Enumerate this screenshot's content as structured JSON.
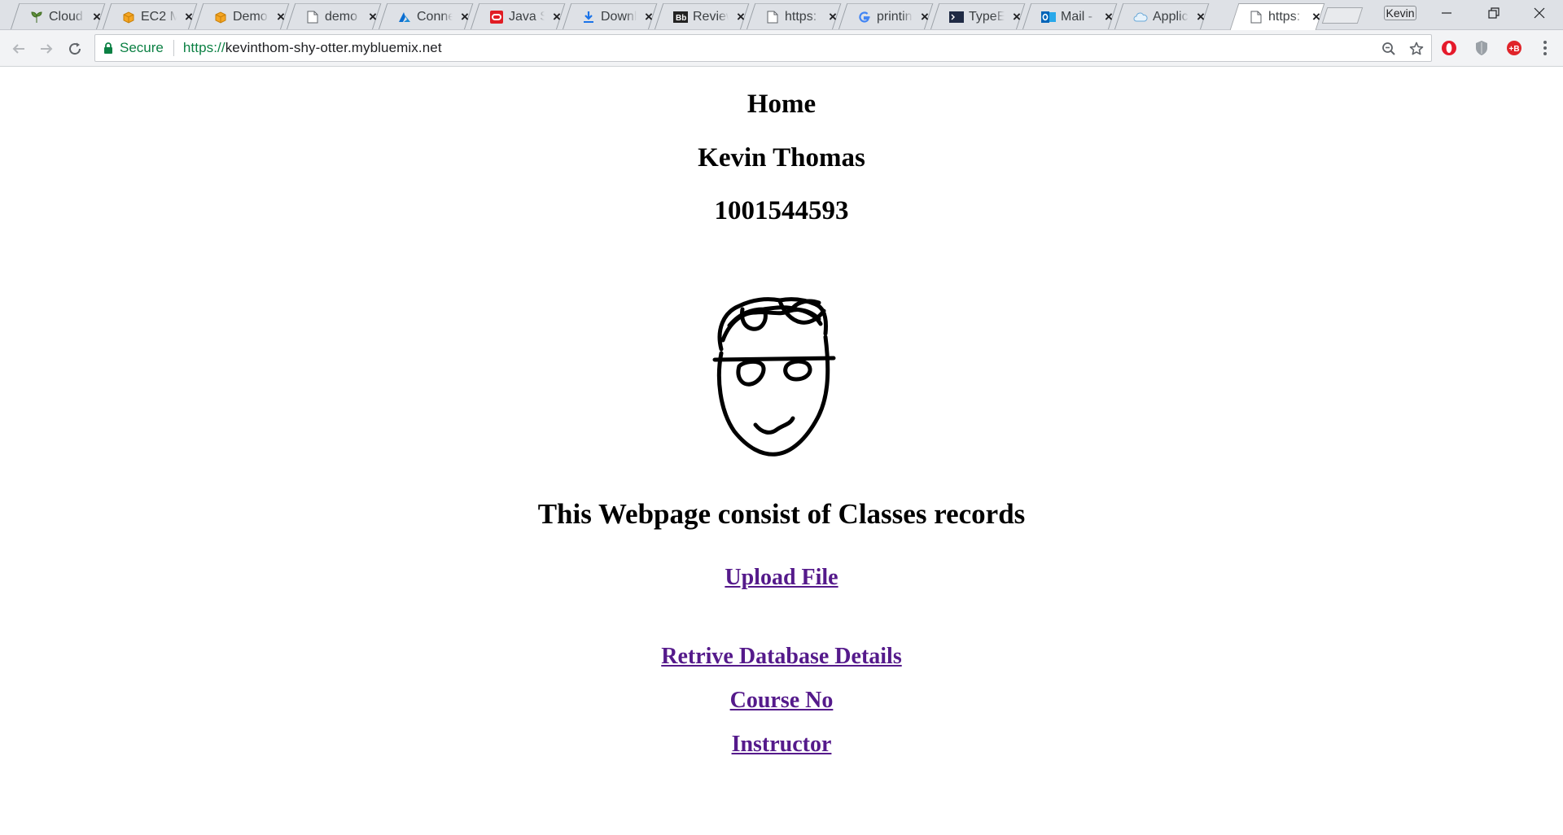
{
  "browser": {
    "tabs": [
      {
        "title": "Cloud",
        "icon": "sprout-icon",
        "active": false
      },
      {
        "title": "EC2 M",
        "icon": "aws-box-icon",
        "active": false
      },
      {
        "title": "Demo",
        "icon": "aws-box-icon",
        "active": false
      },
      {
        "title": "demo",
        "icon": "page-icon",
        "active": false
      },
      {
        "title": "Conne",
        "icon": "azure-icon",
        "active": false
      },
      {
        "title": "Java S",
        "icon": "oracle-icon",
        "active": false
      },
      {
        "title": "Downl",
        "icon": "download-icon",
        "active": false
      },
      {
        "title": "Review",
        "icon": "blackboard-icon",
        "active": false
      },
      {
        "title": "https:",
        "icon": "page-icon",
        "active": false
      },
      {
        "title": "printin",
        "icon": "google-icon",
        "active": false
      },
      {
        "title": "TypeEr",
        "icon": "terminal-icon",
        "active": false
      },
      {
        "title": "Mail -",
        "icon": "outlook-icon",
        "active": false
      },
      {
        "title": "Applic",
        "icon": "cloud-icon",
        "active": false
      },
      {
        "title": "https:",
        "icon": "page-icon",
        "active": true
      }
    ],
    "profile_name": "Kevin",
    "security_label": "Secure",
    "url_scheme": "https://",
    "url_host": "kevinthom-shy-otter.mybluemix.net"
  },
  "page": {
    "home_heading": "Home",
    "name": "Kevin Thomas",
    "student_id": "1001544593",
    "description": "This Webpage consist of Classes records",
    "links": {
      "upload": "Upload File",
      "retrieve": "Retrive Database Details",
      "course": "Course No",
      "instructor": "Instructor"
    }
  },
  "colors": {
    "visited_link": "#551a8b",
    "secure_green": "#0b8043",
    "tabstrip_bg": "#dee1e6"
  }
}
